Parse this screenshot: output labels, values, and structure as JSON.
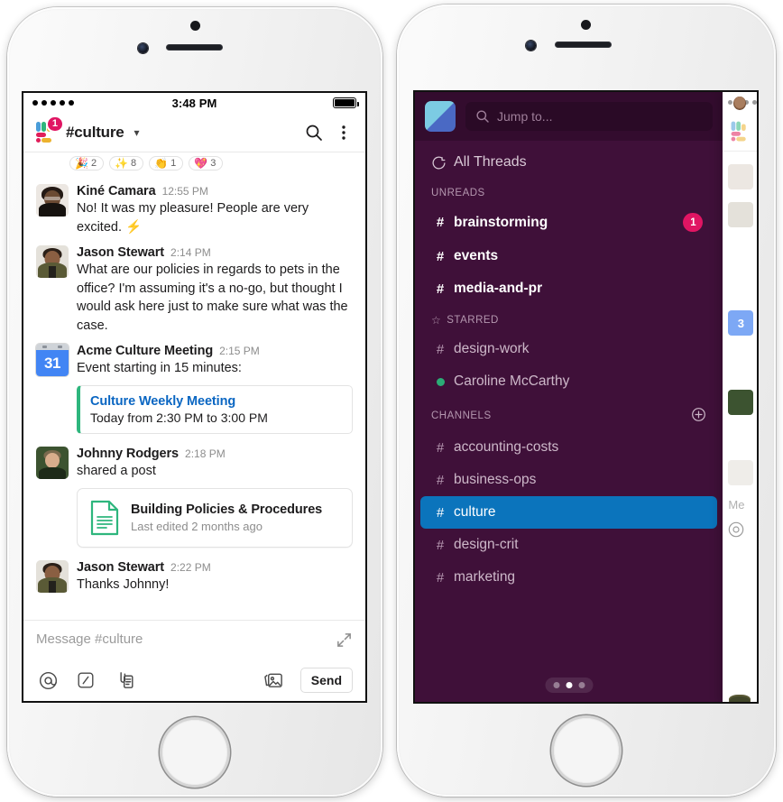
{
  "left_phone": {
    "status_bar": {
      "time": "3:48 PM",
      "signal_dots": 5,
      "battery": "full"
    },
    "header": {
      "workspace_badge": "1",
      "channel": "#culture",
      "caret_icon": "chevron-down-icon",
      "search_icon": "search-icon",
      "more_icon": "more-vertical-icon"
    },
    "reactions": [
      {
        "emoji": "🎉",
        "name": "party-popper-emoji",
        "count": "2"
      },
      {
        "emoji": "✨",
        "name": "sparkles-emoji",
        "count": "8"
      },
      {
        "emoji": "👏",
        "name": "clap-emoji",
        "count": "1"
      },
      {
        "emoji": "💖",
        "name": "sparkling-heart-emoji",
        "count": "3"
      }
    ],
    "messages": [
      {
        "author": "Kiné Camara",
        "time": "12:55 PM",
        "text": "No! It was my pleasure! People are very excited. ⚡"
      },
      {
        "author": "Jason Stewart",
        "time": "2:14 PM",
        "text": "What are our policies in regards to pets in the office? I'm assuming it's a no-go, but thought I would ask here just to make sure what was the case."
      },
      {
        "author": "Acme Culture Meeting",
        "time": "2:15 PM",
        "text": "Event starting in 15 minutes:",
        "attachment": {
          "kind": "event",
          "title": "Culture Weekly Meeting",
          "subtitle": "Today from 2:30 PM to 3:00 PM"
        }
      },
      {
        "author": "Johnny Rodgers",
        "time": "2:18 PM",
        "text": "shared a post",
        "attachment": {
          "kind": "post",
          "title": "Building Policies & Procedures",
          "subtitle": "Last edited 2 months ago"
        }
      },
      {
        "author": "Jason Stewart",
        "time": "2:22 PM",
        "text": "Thanks Johnny!"
      }
    ],
    "composer": {
      "placeholder": "Message #culture",
      "expand_icon": "expand-arrows-icon",
      "mention_icon": "at-mention-icon",
      "slash_icon": "slash-command-icon",
      "attach_icon": "attachment-icon",
      "image_icon": "image-icon",
      "send_label": "Send"
    }
  },
  "right_phone": {
    "sidebar": {
      "workspace_logo": "workspace-logo-icon",
      "search": {
        "placeholder": "Jump to...",
        "icon": "search-icon"
      },
      "all_threads": {
        "label": "All Threads",
        "icon": "threads-icon"
      },
      "sections": [
        {
          "label": "UNREADS",
          "icon": null,
          "add_icon": null,
          "items": [
            {
              "prefix": "#",
              "label": "brainstorming",
              "unread": true,
              "badge": "1"
            },
            {
              "prefix": "#",
              "label": "events",
              "unread": true,
              "badge": null
            },
            {
              "prefix": "#",
              "label": "media-and-pr",
              "unread": true,
              "badge": null
            }
          ]
        },
        {
          "label": "STARRED",
          "icon": "star-icon",
          "add_icon": null,
          "items": [
            {
              "prefix": "#",
              "label": "design-work",
              "unread": false,
              "badge": null
            },
            {
              "prefix": "●",
              "label": "Caroline McCarthy",
              "unread": false,
              "badge": null,
              "presence": true
            }
          ]
        },
        {
          "label": "CHANNELS",
          "icon": null,
          "add_icon": "add-channel-icon",
          "items": [
            {
              "prefix": "#",
              "label": "accounting-costs",
              "unread": false,
              "badge": null
            },
            {
              "prefix": "#",
              "label": "business-ops",
              "unread": false,
              "badge": null
            },
            {
              "prefix": "#",
              "label": "culture",
              "unread": false,
              "badge": null,
              "active": true
            },
            {
              "prefix": "#",
              "label": "design-crit",
              "unread": false,
              "badge": null
            },
            {
              "prefix": "#",
              "label": "marketing",
              "unread": false,
              "badge": null
            }
          ]
        }
      ],
      "pager": {
        "dots": 3,
        "active_index": 1
      }
    },
    "peek_pane": {
      "truncated_placeholder": "Me"
    }
  },
  "colors": {
    "sidebar_purple": "#3F1039",
    "sidebar_purple_dark": "#330C2E",
    "active_channel_blue": "#0B74BC",
    "badge_pink": "#E01563",
    "presence_green": "#2BAC76",
    "event_accent_green": "#2EB67D",
    "link_blue": "#0A66C2",
    "calendar_blue": "#4285F4"
  }
}
